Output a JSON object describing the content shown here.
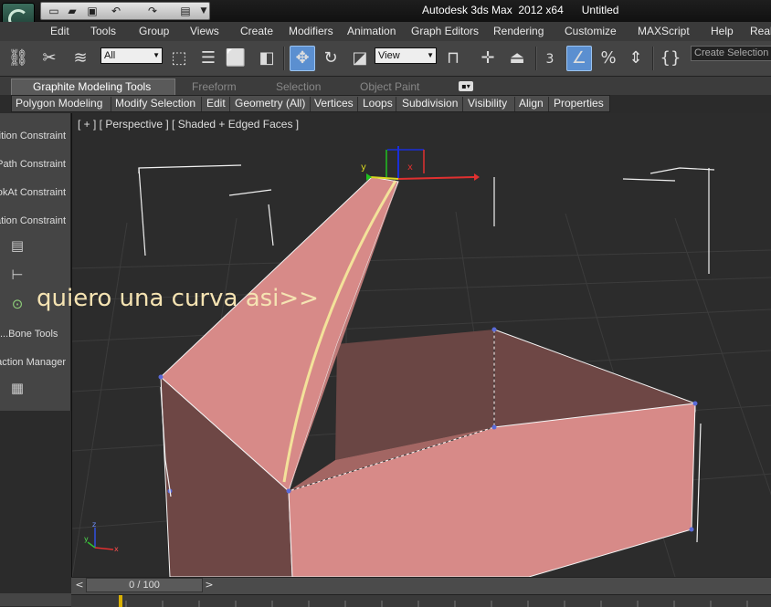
{
  "app": {
    "title": "Autodesk 3ds Max  2012 x64      Untitled"
  },
  "quick_access": {
    "icons": [
      "new-file-icon",
      "open-file-icon",
      "save-icon",
      "undo-icon",
      "redo-icon",
      "project-folder-icon"
    ]
  },
  "menu": {
    "items": [
      "Edit",
      "Tools",
      "Group",
      "Views",
      "Create",
      "Modifiers",
      "Animation",
      "Graph Editors",
      "Rendering",
      "Customize",
      "MAXScript",
      "Help",
      "Real"
    ]
  },
  "toolbar": {
    "selection_filter": "All",
    "ref_coord": "View",
    "snap_value": "3",
    "named_selection_placeholder": "Create Selection S"
  },
  "ribbon": {
    "tabs": [
      "Graphite Modeling Tools",
      "Freeform",
      "Selection",
      "Object Paint"
    ],
    "panel_items": [
      "Polygon Modeling",
      "Modify Selection",
      "Edit",
      "Geometry (All)",
      "Vertices",
      "Loops",
      "Subdivision",
      "Visibility",
      "Align",
      "Properties"
    ]
  },
  "left_panel": {
    "items": [
      "Position Constraint",
      "Path Constraint",
      "LookAt Constraint",
      "Orientation Constraint",
      "Bone Tools...",
      "Reaction Manager"
    ]
  },
  "viewport": {
    "label": "[ + ] [ Perspective ] [ Shaded + Edged Faces ]",
    "annotation": "quiero una curva asi>>",
    "gizmo_axis_x": "x",
    "gizmo_axis_y": "y",
    "gizmo_axis_z": "z"
  },
  "timeline": {
    "slider_label": "0 / 100"
  },
  "colors": {
    "object_face": "#d78a88",
    "object_face_dark": "#6e4745",
    "curve": "#f3e29a",
    "viewport_bg": "#2c2c2c",
    "active_button": "#5b8fd0"
  }
}
